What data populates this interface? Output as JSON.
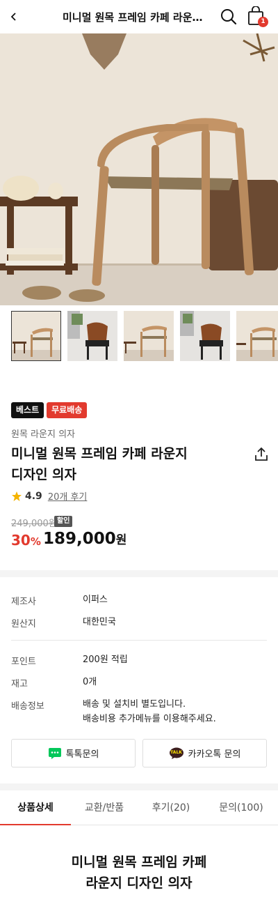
{
  "header": {
    "title": "미니멀 원목 프레임 카페 라운지...",
    "cart_count": "1",
    "icons": {
      "back": "chevron-left-icon",
      "search": "search-icon",
      "cart": "shopping-bag-icon"
    }
  },
  "product": {
    "badges": [
      "베스트",
      "무료배송"
    ],
    "category": "원목 라운지 의자",
    "title_line1": "미니멀 원목 프레임 카페 라운지",
    "title_line2": "디자인 의자",
    "rating": "4.9",
    "review_count": "20개 후기",
    "original_price": "249,000원",
    "sale_tag": "할인",
    "discount_value": "30",
    "discount_unit": "%",
    "price_value": "189,000",
    "price_unit": "원"
  },
  "info": {
    "manufacturer_label": "제조사",
    "manufacturer": "이퍼스",
    "origin_label": "원산지",
    "origin": "대한민국",
    "points_label": "포인트",
    "points": "200원 적립",
    "stock_label": "재고",
    "stock": "0개",
    "shipping_label": "배송정보",
    "shipping_line1": "배송 및 설치비 별도입니다.",
    "shipping_line2": "배송비용 추가메뉴를 이용해주세요."
  },
  "cs": {
    "talktalk": "톡톡문의",
    "kakao": "카카오톡 문의",
    "kakao_icon_text": "TALK"
  },
  "tabs": [
    "상품상세",
    "교환/반품",
    "후기(20)",
    "문의(100)"
  ],
  "detail": {
    "title_line1": "미니멀 원목 프레임 카페",
    "title_line2": "라운지 디자인 의자"
  },
  "colors": {
    "accent": "#e23a2e",
    "naver_green": "#03c75a",
    "kakao_yellow": "#fee500"
  }
}
